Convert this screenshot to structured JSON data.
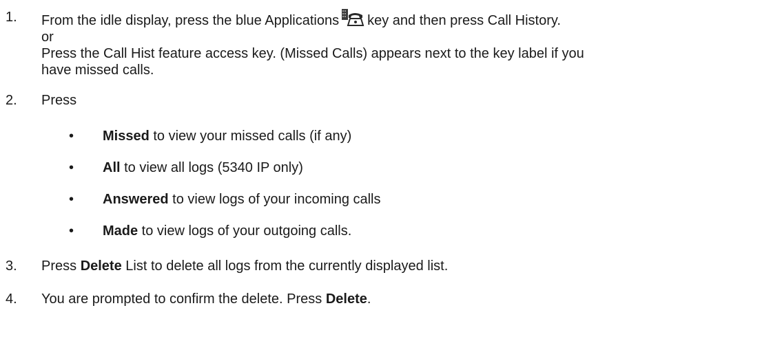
{
  "steps": [
    {
      "num": "1.",
      "line1_before": "From the idle display, press the blue Applications",
      "line1_after": "key and then press Call History.",
      "line2": "or",
      "line3": "Press the Call Hist feature access key. (Missed Calls) appears next to the key label if you",
      "line4": "have missed calls.",
      "icon": "applications-key-icon"
    },
    {
      "num": "2.",
      "text": "Press",
      "bullets": [
        {
          "bold": "Missed",
          "rest": " to view your missed calls (if any)"
        },
        {
          "bold": "All",
          "rest": " to view all logs (5340 IP only)"
        },
        {
          "bold": "Answered",
          "rest": " to view logs of your incoming calls"
        },
        {
          "bold": "Made",
          "rest": " to view logs of your outgoing calls."
        }
      ]
    },
    {
      "num": "3.",
      "before": "Press ",
      "bold": "Delete",
      "after": " List to delete all logs from the currently displayed list."
    },
    {
      "num": "4.",
      "before": "You are prompted to confirm the delete. Press ",
      "bold": "Delete",
      "after": "."
    }
  ],
  "bullet_char": "•",
  "colors": {
    "text": "#1a1a1a",
    "icon_phone": "#2a2a2a",
    "icon_device": "#4a4a4a"
  }
}
